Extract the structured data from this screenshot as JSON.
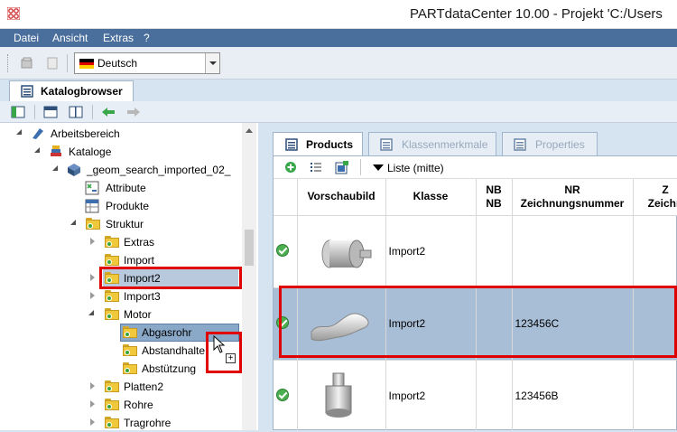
{
  "window": {
    "title": "PARTdataCenter 10.00 - Projekt 'C:/Users"
  },
  "menu": [
    "Datei",
    "Ansicht",
    "Extras",
    "?"
  ],
  "toolbar": {
    "language": "Deutsch"
  },
  "dock": {
    "tab_label": "Katalogbrowser"
  },
  "tree": {
    "rows": [
      {
        "label": "Arbeitsbereich"
      },
      {
        "label": "Kataloge"
      },
      {
        "label": "_geom_search_imported_02_"
      },
      {
        "label": "Attribute"
      },
      {
        "label": "Produkte"
      },
      {
        "label": "Struktur"
      },
      {
        "label": "Extras"
      },
      {
        "label": "Import"
      },
      {
        "label": "Import2"
      },
      {
        "label": "Import3"
      },
      {
        "label": "Motor"
      },
      {
        "label": "Abgasrohr"
      },
      {
        "label": "Abstandhalte"
      },
      {
        "label": "Abstützung"
      },
      {
        "label": "Platten2"
      },
      {
        "label": "Rohre"
      },
      {
        "label": "Tragrohre"
      }
    ]
  },
  "right_tabs": [
    {
      "label": "Products"
    },
    {
      "label": "Klassenmerkmale"
    },
    {
      "label": "Properties"
    }
  ],
  "list_mode": "Liste (mitte)",
  "table": {
    "columns": [
      {
        "line1": "",
        "line2": ""
      },
      {
        "line1": "Vorschaubild",
        "line2": ""
      },
      {
        "line1": "Klasse",
        "line2": ""
      },
      {
        "line1": "NB",
        "line2": "NB"
      },
      {
        "line1": "NR",
        "line2": "Zeichnungsnummer"
      },
      {
        "line1": "Z",
        "line2": "Zeichn"
      }
    ],
    "rows": [
      {
        "klasse": "Import2",
        "nb": "",
        "nr": ""
      },
      {
        "klasse": "Import2",
        "nb": "",
        "nr": "123456C"
      },
      {
        "klasse": "Import2",
        "nb": "",
        "nr": "123456B"
      }
    ]
  },
  "colors": {
    "menubar": "#4a6f9c",
    "selection": "#a8bed6",
    "highlight": "#e00000"
  }
}
